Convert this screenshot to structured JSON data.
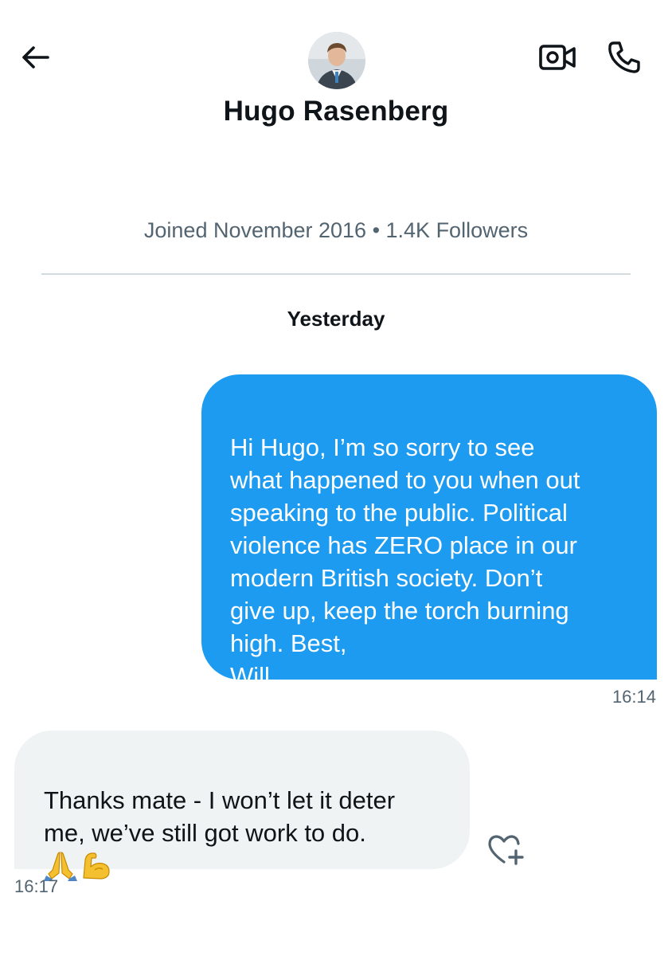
{
  "header": {
    "back_icon": "arrow-left-icon",
    "video_icon": "video-camera-icon",
    "call_icon": "phone-icon",
    "avatar_icon": "avatar-photo"
  },
  "contact": {
    "name": "Hugo Rasenberg",
    "meta": "Joined November 2016 • 1.4K Followers"
  },
  "conversation": {
    "day_label": "Yesterday",
    "messages": [
      {
        "direction": "outgoing",
        "text": "Hi Hugo, I’m so sorry to see\nwhat happened to you when out\nspeaking to the public. Political\nviolence has ZERO place in our\nmodern British society. Don’t\ngive up, keep the torch burning\nhigh. Best,\nWill",
        "time": "16:14"
      },
      {
        "direction": "incoming",
        "text": "Thanks mate - I won’t let it deter\nme, we’ve still got work to do.",
        "emojis": [
          "folded-hands-emoji",
          "flexed-biceps-emoji"
        ],
        "time": "16:17"
      }
    ],
    "react_icon": "heart-plus-icon"
  },
  "colors": {
    "accent": "#1d9bf0",
    "incoming_bubble": "#eff3f4",
    "secondary_text": "#536471",
    "divider": "#cfd9de"
  }
}
